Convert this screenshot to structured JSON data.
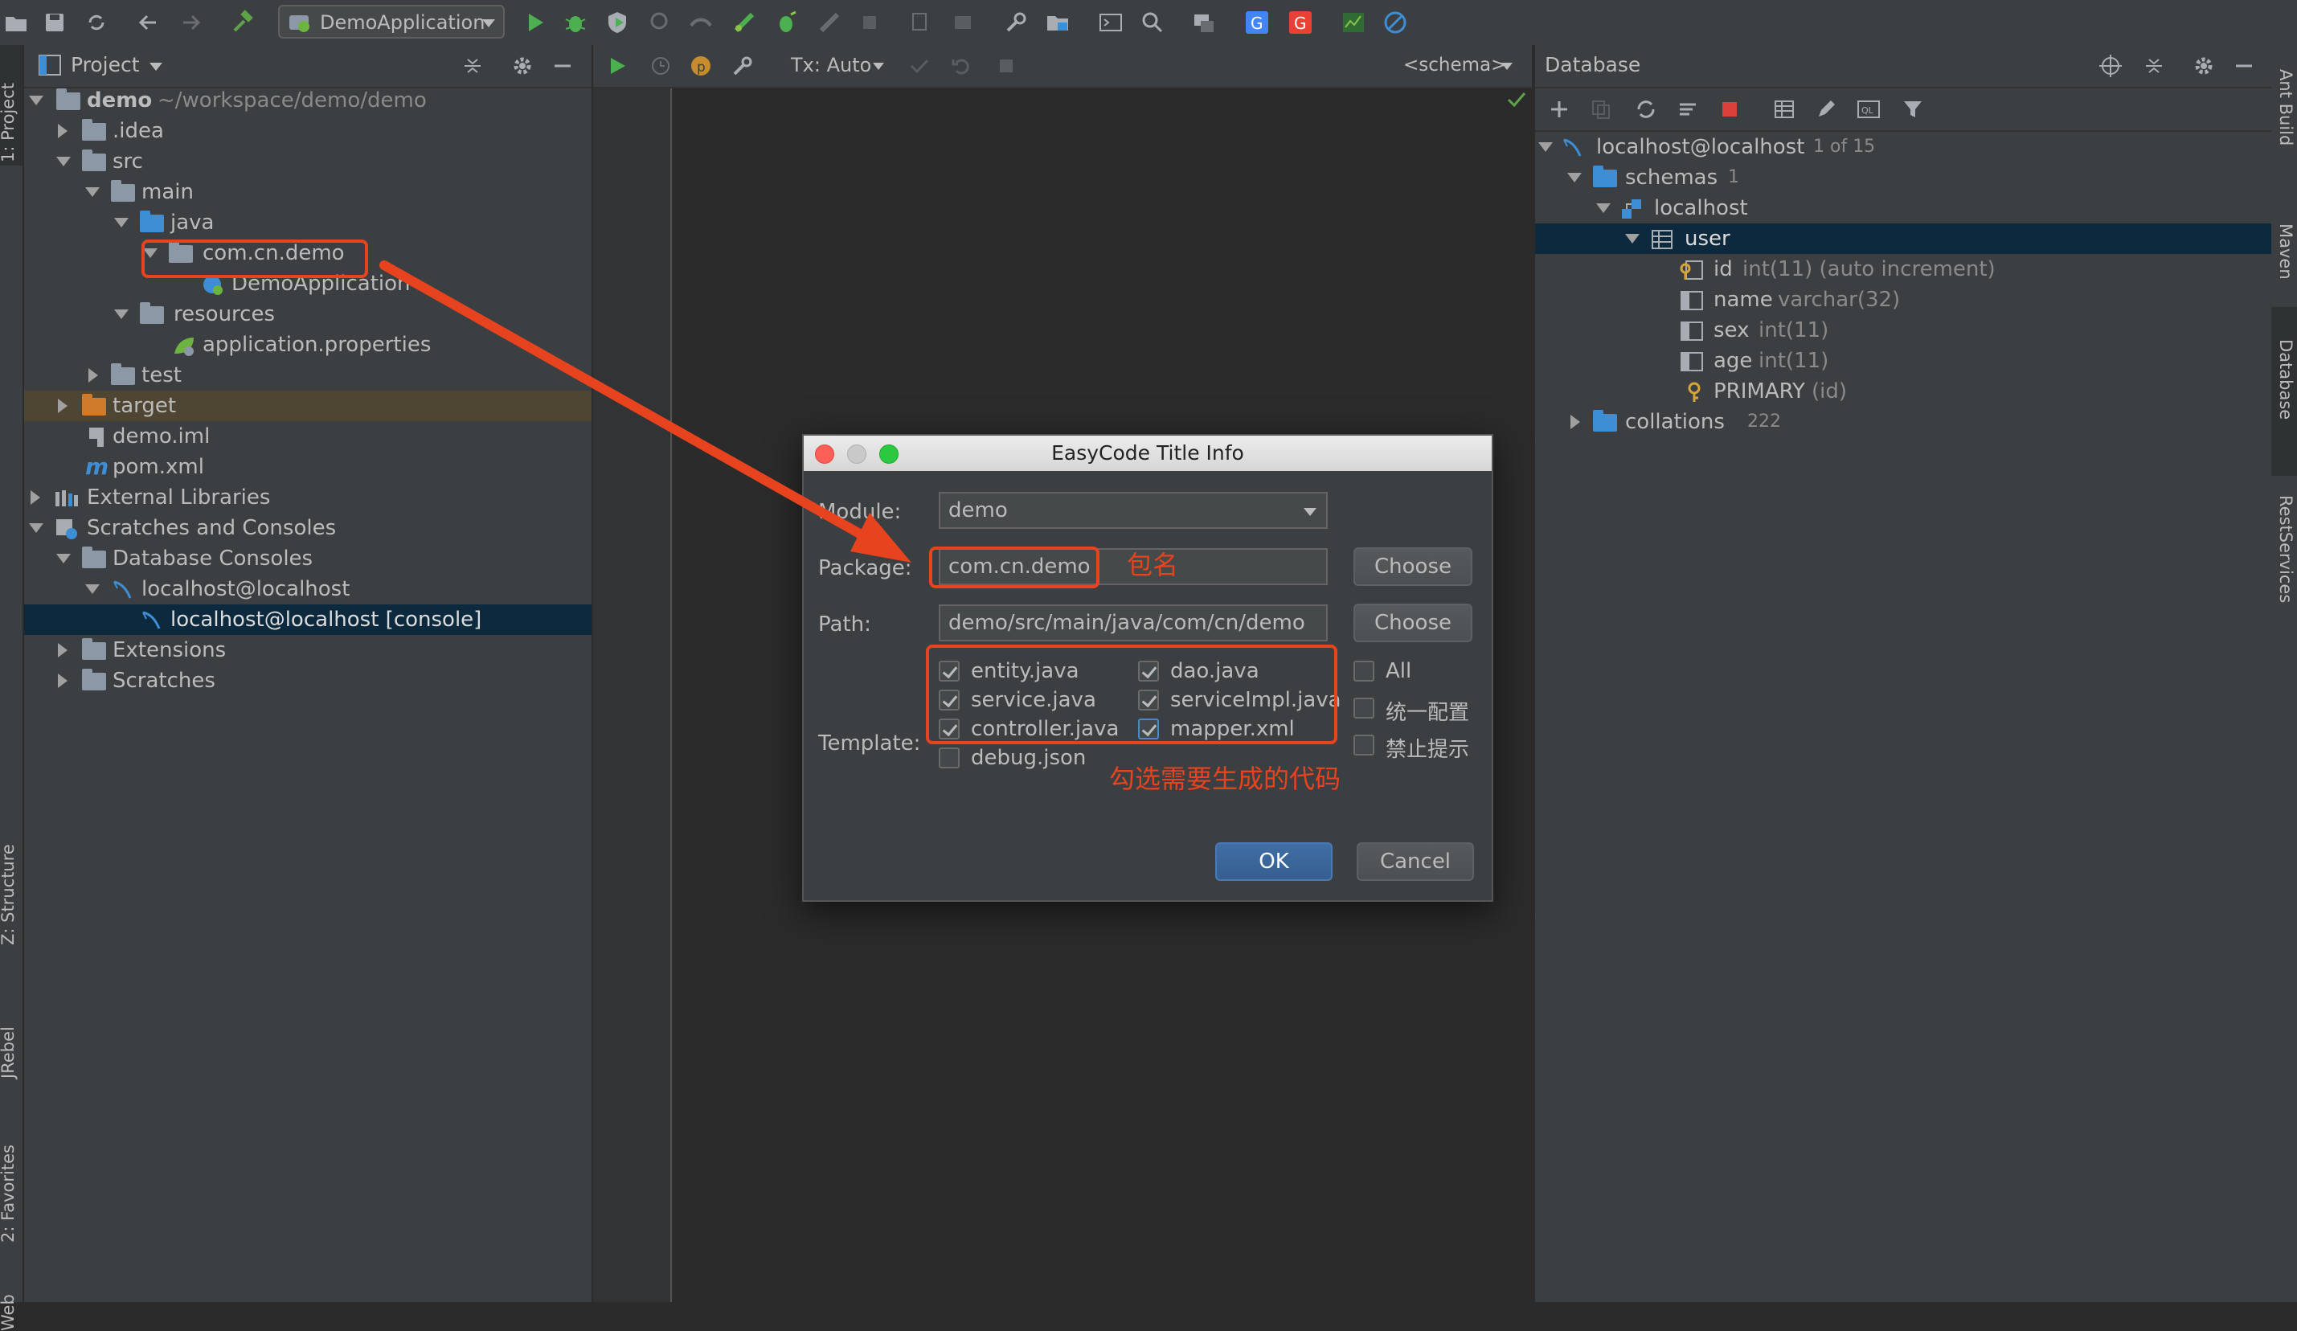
{
  "colors": {
    "accent_annotation": "#e8431f",
    "selection": "#0d293e",
    "panel_bg": "#3c3f41",
    "editor_bg": "#2b2b2b",
    "run_green": "#4caf50",
    "stop_red": "#d9413a"
  },
  "toolbar": {
    "run_config": "DemoApplication"
  },
  "left_strip": {
    "tabs": [
      "1: Project",
      "Z: Structure",
      "JRebel",
      "2: Favorites",
      "Web"
    ]
  },
  "project": {
    "title": "Project",
    "tree": {
      "demo_name": "demo",
      "demo_path": "~/workspace/demo/demo",
      "idea": ".idea",
      "src": "src",
      "main": "main",
      "java": "java",
      "package": "com.cn.demo",
      "demo_app": "DemoApplication",
      "resources": "resources",
      "app_props": "application.properties",
      "test": "test",
      "target": "target",
      "demo_iml": "demo.iml",
      "pom": "pom.xml",
      "external_libs": "External Libraries",
      "scratches_consoles": "Scratches and Consoles",
      "db_consoles": "Database Consoles",
      "localhost": "localhost@localhost",
      "console": "localhost@localhost [console]",
      "extensions": "Extensions",
      "scratches": "Scratches"
    }
  },
  "editor": {
    "tx_mode": "Tx: Auto",
    "schema": "<schema>"
  },
  "database": {
    "title": "Database",
    "root": "localhost@localhost",
    "root_count": "1 of 15",
    "schemas": "schemas",
    "schemas_count": "1",
    "localhost": "localhost",
    "user": "user",
    "columns": [
      {
        "name": "id",
        "type": "int(11) (auto increment)"
      },
      {
        "name": "name",
        "type": "varchar(32)"
      },
      {
        "name": "sex",
        "type": "int(11)"
      },
      {
        "name": "age",
        "type": "int(11)"
      }
    ],
    "primary": "PRIMARY",
    "primary_detail": "(id)",
    "collations": "collations",
    "collations_count": "222"
  },
  "right_strip": {
    "tabs": [
      "Ant Build",
      "Maven",
      "Database",
      "RestServices"
    ]
  },
  "dialog": {
    "title": "EasyCode Title Info",
    "module_label": "Module:",
    "module_value": "demo",
    "package_label": "Package:",
    "package_value": "com.cn.demo",
    "path_label": "Path:",
    "path_value": "demo/src/main/java/com/cn/demo",
    "choose": "Choose",
    "template_label": "Template:",
    "templates": [
      {
        "label": "entity.java",
        "checked": true
      },
      {
        "label": "dao.java",
        "checked": true
      },
      {
        "label": "service.java",
        "checked": true
      },
      {
        "label": "serviceImpl.java",
        "checked": true
      },
      {
        "label": "controller.java",
        "checked": true
      },
      {
        "label": "mapper.xml",
        "checked": true
      },
      {
        "label": "debug.json",
        "checked": false
      }
    ],
    "options": [
      {
        "label": "All",
        "checked": false
      },
      {
        "label": "统一配置",
        "checked": false
      },
      {
        "label": "禁止提示",
        "checked": false
      }
    ],
    "ok": "OK",
    "cancel": "Cancel"
  },
  "annotations": {
    "package_note": "包名",
    "template_note": "勾选需要生成的代码"
  }
}
